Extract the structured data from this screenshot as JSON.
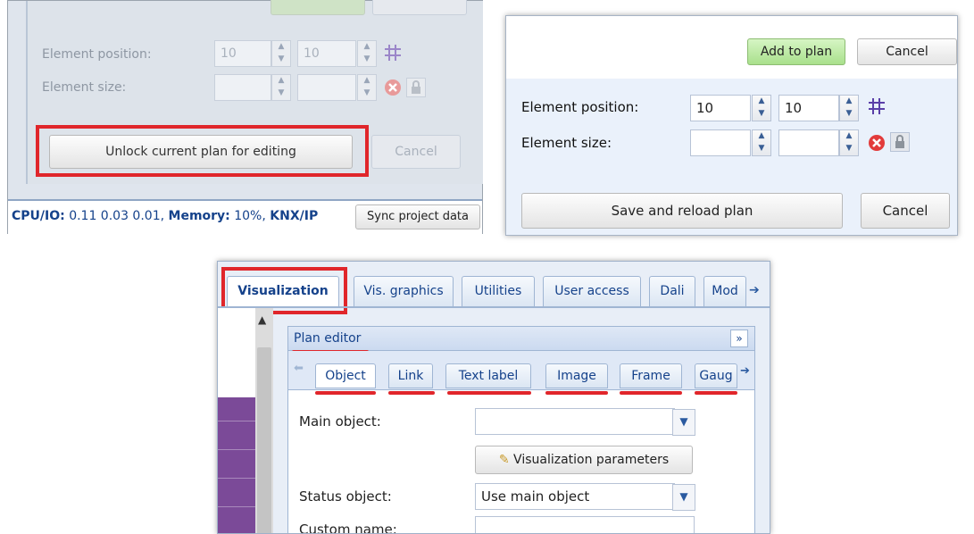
{
  "locked_panel": {
    "position_label": "Element position:",
    "size_label": "Element size:",
    "pos_x": "10",
    "pos_y": "10",
    "unlock_button": "Unlock current plan for editing",
    "cancel_button": "Cancel",
    "status": {
      "cpu_label": "CPU/IO:",
      "cpu_value": "0.11 0.03 0.01,",
      "memory_label": "Memory:",
      "memory_value": "10%,",
      "knx_label": "KNX/IP",
      "sync_button": "Sync project data"
    }
  },
  "unlocked_panel": {
    "add_button": "Add to plan",
    "cancel_top_button": "Cancel",
    "position_label": "Element position:",
    "size_label": "Element size:",
    "pos_x": "10",
    "pos_y": "10",
    "save_button": "Save and reload plan",
    "cancel_button": "Cancel"
  },
  "visualization_panel": {
    "tabs": [
      "Visualization",
      "Vis. graphics",
      "Utilities",
      "User access",
      "Dali",
      "Mod"
    ],
    "active_tab": "Visualization",
    "plan_editor_title": "Plan editor",
    "collapse_glyph": "»",
    "subtabs": [
      "Object",
      "Link",
      "Text label",
      "Image",
      "Frame",
      "Gaug"
    ],
    "active_subtab": "Object",
    "main_object_label": "Main object:",
    "main_object_value": "",
    "vis_params_button": "Visualization parameters",
    "status_object_label": "Status object:",
    "status_object_value": "Use main object",
    "custom_name_label": "Custom name:",
    "custom_name_value": ""
  },
  "colors": {
    "highlight": "#e0262b",
    "accent_text": "#15428b",
    "add_button_green": "#bfe9a8"
  },
  "icons": [
    "grid-icon",
    "remove-icon",
    "lock-icon",
    "scroll-up-icon",
    "tab-scroll-left-icon",
    "tab-scroll-right-icon",
    "dropdown-icon",
    "edit-pencil-icon"
  ]
}
